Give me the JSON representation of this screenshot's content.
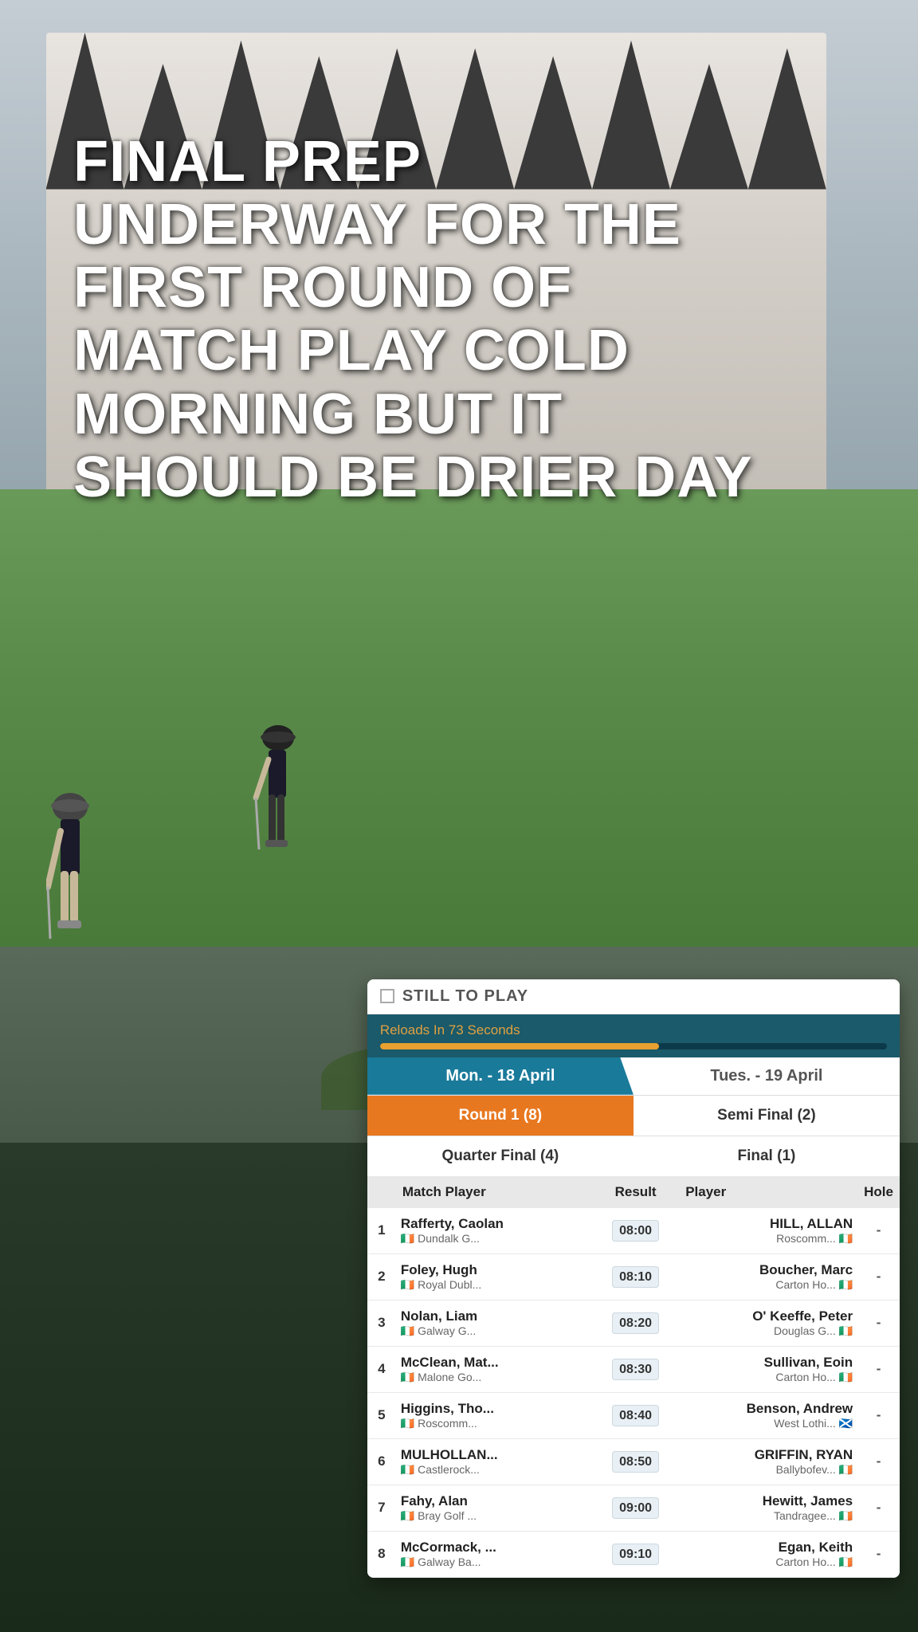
{
  "page": {
    "dimensions": "1152x2048"
  },
  "headline": {
    "text": "FINAL PREP UNDERWAY FOR THE FIRST ROUND OF MATCH PLAY COLD MORNING BUT IT SHOULD BE DRIER DAY"
  },
  "panel": {
    "still_to_play_label": "STILL TO PLAY",
    "reload_text": "Reloads In 73 Seconds",
    "reload_progress_pct": 55,
    "day_tabs": [
      {
        "label": "Mon. - 18 April",
        "active": true
      },
      {
        "label": "Tues. - 19 April",
        "active": false
      }
    ],
    "round_tabs": [
      {
        "label": "Round 1 (8)",
        "active": true
      },
      {
        "label": "Semi Final (2)",
        "active": false
      },
      {
        "label": "Quarter Final (4)",
        "active": false
      },
      {
        "label": "Final (1)",
        "active": false
      }
    ],
    "table": {
      "headers": [
        "",
        "Match Player",
        "Result",
        "Player",
        "Hole"
      ],
      "rows": [
        {
          "num": 1,
          "player1_name": "Rafferty, Caolan",
          "player1_club": "Dundalk G...",
          "player1_flag": "🇮🇪",
          "time": "08:00",
          "player2_name": "HILL, ALLAN",
          "player2_club": "Roscomm...",
          "player2_flag": "🇮🇪",
          "hole": "-"
        },
        {
          "num": 2,
          "player1_name": "Foley, Hugh",
          "player1_club": "Royal Dubl...",
          "player1_flag": "🇮🇪",
          "time": "08:10",
          "player2_name": "Boucher, Marc",
          "player2_club": "Carton Ho...",
          "player2_flag": "🇮🇪",
          "hole": "-"
        },
        {
          "num": 3,
          "player1_name": "Nolan, Liam",
          "player1_club": "Galway G...",
          "player1_flag": "🇮🇪",
          "time": "08:20",
          "player2_name": "O' Keeffe, Peter",
          "player2_club": "Douglas G...",
          "player2_flag": "🇮🇪",
          "hole": "-"
        },
        {
          "num": 4,
          "player1_name": "McClean, Mat...",
          "player1_club": "Malone Go...",
          "player1_flag": "🇮🇪",
          "time": "08:30",
          "player2_name": "Sullivan, Eoin",
          "player2_club": "Carton Ho...",
          "player2_flag": "🇮🇪",
          "hole": "-"
        },
        {
          "num": 5,
          "player1_name": "Higgins, Tho...",
          "player1_club": "Roscomm...",
          "player1_flag": "🇮🇪",
          "time": "08:40",
          "player2_name": "Benson, Andrew",
          "player2_club": "West Lothi...",
          "player2_flag": "🏴󠁧󠁢󠁳󠁣󠁴󠁿",
          "hole": "-"
        },
        {
          "num": 6,
          "player1_name": "MULHOLLAN...",
          "player1_club": "Castlerock...",
          "player1_flag": "🇮🇪",
          "time": "08:50",
          "player2_name": "GRIFFIN, RYAN",
          "player2_club": "Ballybofev...",
          "player2_flag": "🇮🇪",
          "hole": "-"
        },
        {
          "num": 7,
          "player1_name": "Fahy, Alan",
          "player1_club": "Bray Golf ...",
          "player1_flag": "🇮🇪",
          "time": "09:00",
          "player2_name": "Hewitt, James",
          "player2_club": "Tandragee...",
          "player2_flag": "🇮🇪",
          "hole": "-"
        },
        {
          "num": 8,
          "player1_name": "McCormack, ...",
          "player1_club": "Galway Ba...",
          "player1_flag": "🇮🇪",
          "time": "09:10",
          "player2_name": "Egan, Keith",
          "player2_club": "Carton Ho...",
          "player2_flag": "🇮🇪",
          "hole": "-"
        }
      ]
    }
  }
}
